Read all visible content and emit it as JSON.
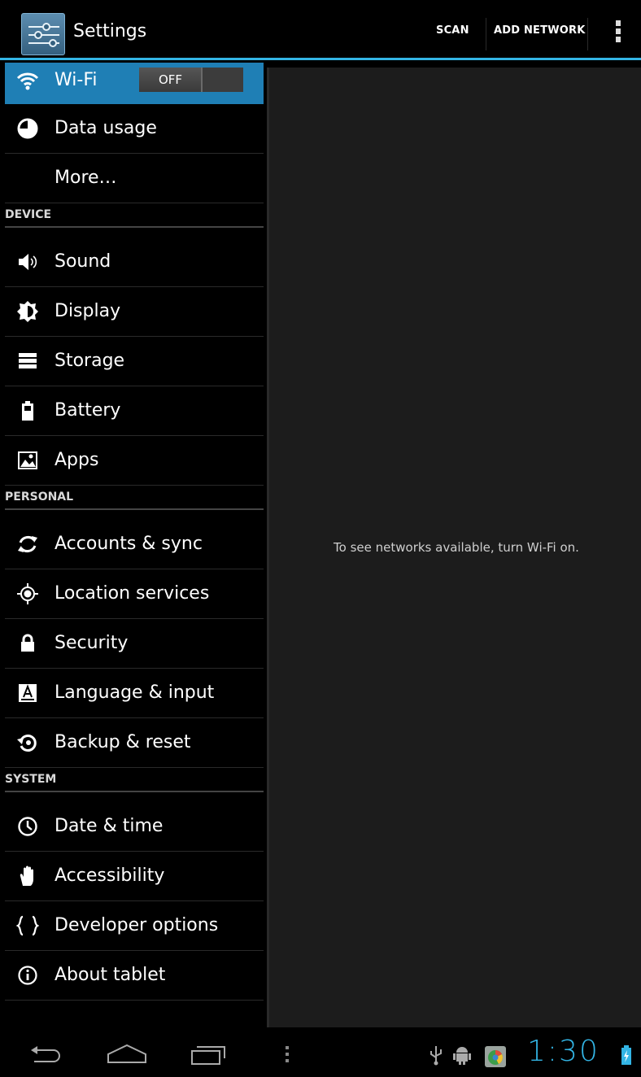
{
  "actionbar": {
    "title": "Settings",
    "scan_label": "SCAN",
    "add_network_label": "ADD NETWORK"
  },
  "colors": {
    "accent": "#33b5e5",
    "selected_row": "#1f7fb5",
    "detail_background": "#1c1c1c"
  },
  "list": {
    "wifi": {
      "label": "Wi-Fi",
      "toggle": "OFF",
      "icon": "wifi-icon"
    },
    "data_usage": {
      "label": "Data usage",
      "icon": "data-usage-icon"
    },
    "more": {
      "label": "More…"
    },
    "section_device": "DEVICE",
    "sound": {
      "label": "Sound",
      "icon": "speaker-icon"
    },
    "display": {
      "label": "Display",
      "icon": "brightness-icon"
    },
    "storage": {
      "label": "Storage",
      "icon": "storage-icon"
    },
    "battery": {
      "label": "Battery",
      "icon": "battery-icon"
    },
    "apps": {
      "label": "Apps",
      "icon": "apps-icon"
    },
    "section_personal": "PERSONAL",
    "accounts": {
      "label": "Accounts & sync",
      "icon": "sync-icon"
    },
    "location": {
      "label": "Location services",
      "icon": "location-icon"
    },
    "security": {
      "label": "Security",
      "icon": "lock-icon"
    },
    "language": {
      "label": "Language & input",
      "icon": "keyboard-icon"
    },
    "backup": {
      "label": "Backup & reset",
      "icon": "backup-icon"
    },
    "section_system": "SYSTEM",
    "datetime": {
      "label": "Date & time",
      "icon": "clock-icon"
    },
    "accessibility": {
      "label": "Accessibility",
      "icon": "hand-icon"
    },
    "developer": {
      "label": "Developer options",
      "icon": "braces-icon"
    },
    "about": {
      "label": "About tablet",
      "icon": "info-icon"
    }
  },
  "detail": {
    "message": "To see networks available, turn Wi-Fi on."
  },
  "statusbar": {
    "time": "1:30"
  }
}
